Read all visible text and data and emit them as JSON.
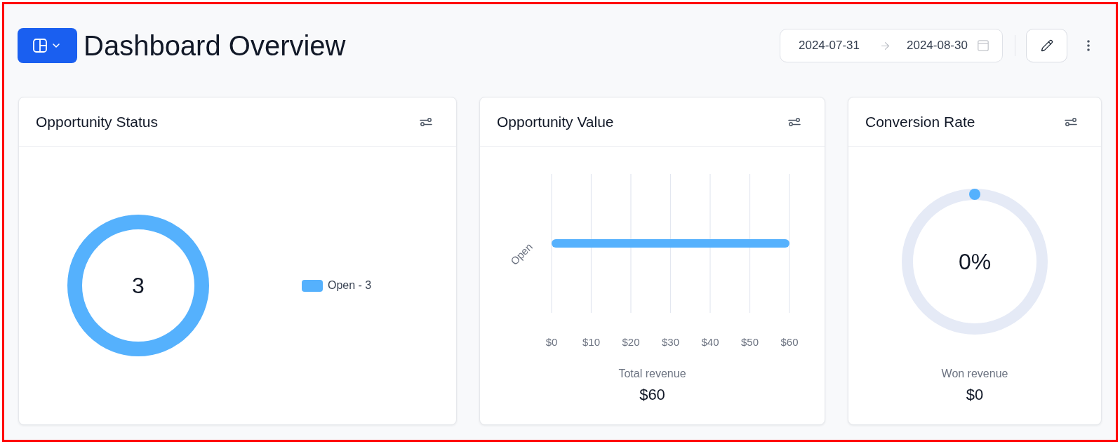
{
  "header": {
    "title": "Dashboard Overview",
    "date_range": {
      "start": "2024-07-31",
      "end": "2024-08-30"
    }
  },
  "cards": [
    {
      "kind": "donut",
      "title": "Opportunity Status",
      "center_label": "3",
      "legend": [
        {
          "label": "Open - 3"
        }
      ]
    },
    {
      "kind": "bar",
      "title": "Opportunity Value",
      "chart_data": {
        "type": "bar",
        "orientation": "horizontal",
        "grid": true,
        "categories": [
          "Open"
        ],
        "values": [
          60
        ],
        "xlim": [
          0,
          60
        ],
        "xticks": [
          {
            "value": 0,
            "label": "$0"
          },
          {
            "value": 10,
            "label": "$10"
          },
          {
            "value": 20,
            "label": "$20"
          },
          {
            "value": 30,
            "label": "$30"
          },
          {
            "value": 40,
            "label": "$40"
          },
          {
            "value": 50,
            "label": "$50"
          },
          {
            "value": 60,
            "label": "$60"
          }
        ]
      },
      "summary": {
        "label": "Total revenue",
        "value": "$60"
      }
    },
    {
      "kind": "gauge",
      "title": "Conversion Rate",
      "gauge": {
        "reading": "0%"
      },
      "summary": {
        "label": "Won revenue",
        "value": "$0"
      }
    }
  ]
}
